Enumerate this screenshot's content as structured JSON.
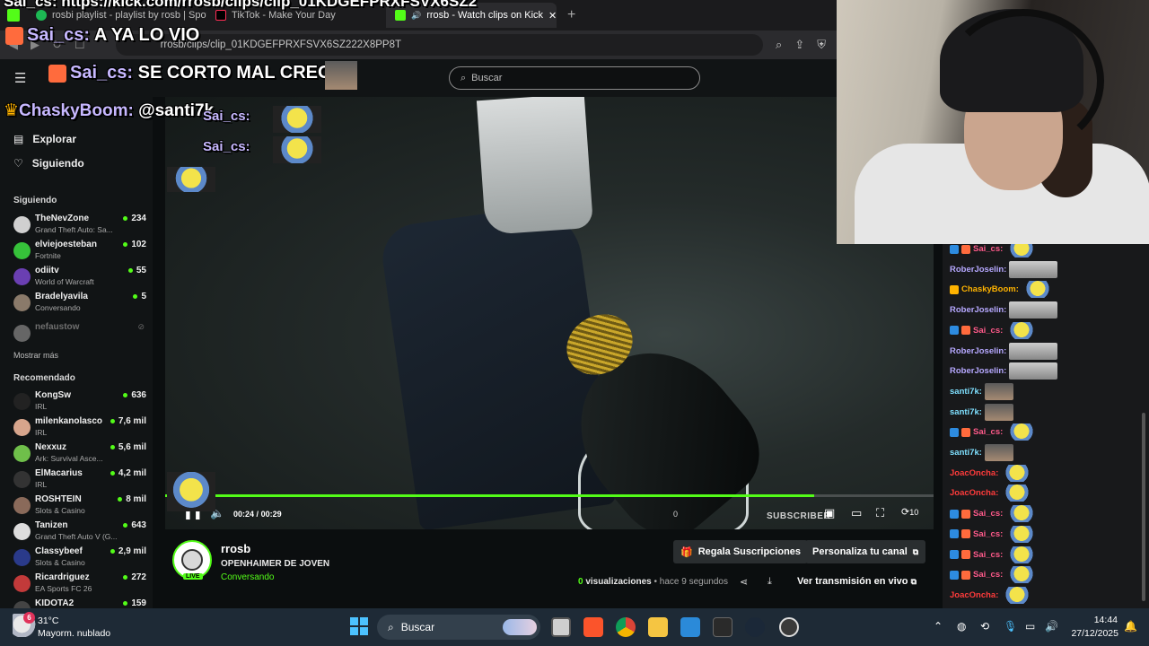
{
  "browser": {
    "tabs": [
      {
        "label": "rosbi playlist - playlist by rosb | Spoti",
        "favicon_color": "#1db954"
      },
      {
        "label": "TikTok - Make Your Day",
        "favicon_color": "#000000"
      },
      {
        "label": "rrosb - Watch clips on Kick",
        "favicon_color": "#53fc18"
      }
    ],
    "new_tab": "+",
    "close_tab": "✕",
    "url": "rrosb/clips/clip_01KDGEFPRXFSVX6SZ222X8PP8T"
  },
  "header": {
    "search_placeholder": "Buscar"
  },
  "sidebar": {
    "nav": [
      {
        "label": "Explorar",
        "icon": "compass-icon"
      },
      {
        "label": "Siguiendo",
        "icon": "heart-icon"
      }
    ],
    "following_title": "Siguiendo",
    "following": [
      {
        "name": "TheNevZone",
        "game": "Grand Theft Auto: Sa...",
        "viewers": "234",
        "avatar_color": "#d0d0d0"
      },
      {
        "name": "elviejoesteban",
        "game": "Fortnite",
        "viewers": "102",
        "avatar_color": "#36c23a"
      },
      {
        "name": "odiitv",
        "game": "World of Warcraft",
        "viewers": "55",
        "avatar_color": "#6a3fb2"
      },
      {
        "name": "Bradelyavila",
        "game": "Conversando",
        "viewers": "5",
        "avatar_color": "#8a7a6a"
      }
    ],
    "offline_channel": "nefaustow",
    "show_more": "Mostrar más",
    "recommended_title": "Recomendado",
    "recommended": [
      {
        "name": "KongSw",
        "game": "IRL",
        "viewers": "636",
        "avatar_color": "#222222"
      },
      {
        "name": "milenkanolasco",
        "game": "IRL",
        "viewers": "7,6 mil",
        "avatar_color": "#d7a58c"
      },
      {
        "name": "Nexxuz",
        "game": "Ark: Survival Asce...",
        "viewers": "5,6 mil",
        "avatar_color": "#6fbf4a"
      },
      {
        "name": "ElMacarius",
        "game": "IRL",
        "viewers": "4,2 mil",
        "avatar_color": "#333333"
      },
      {
        "name": "ROSHTEIN",
        "game": "Slots & Casino",
        "viewers": "8 mil",
        "avatar_color": "#8a6a5a"
      },
      {
        "name": "Tanizen",
        "game": "Grand Theft Auto V (G...",
        "viewers": "643",
        "avatar_color": "#dddddd"
      },
      {
        "name": "Classybeef",
        "game": "Slots & Casino",
        "viewers": "2,9 mil",
        "avatar_color": "#2a3a8a"
      },
      {
        "name": "Ricardriguez",
        "game": "EA Sports FC 26",
        "viewers": "272",
        "avatar_color": "#c23a3a"
      },
      {
        "name": "KIDOTA2",
        "game": "",
        "viewers": "159",
        "avatar_color": "#444444"
      }
    ]
  },
  "player": {
    "current_time": "00:24",
    "separator": "/",
    "duration": "00:29",
    "progress": 0.845,
    "overlay_subscriber": "SUBSCRIBER",
    "overlay_zero": "0",
    "skip_label": "10"
  },
  "channel": {
    "name": "rrosb",
    "live_badge": "LIVE",
    "title": "OPENHAIMER DE JOVEN",
    "category": "Conversando",
    "gift_button": "Regala Suscripciones",
    "customize_button": "Personaliza tu canal",
    "views_count": "0",
    "views_label": "visualizaciones",
    "time_ago": "• hace 9 segundos",
    "watch_live": "Ver transmisión en vivo"
  },
  "stream_overlay": {
    "url": "Sai_cs: https://kick.com/rrosb/clips/clip_01KDGEFPRXFSVX6SZ2",
    "lines": [
      {
        "user": "Sai_cs:",
        "text": "A YA LO VIO"
      },
      {
        "user": "Sai_cs:",
        "text": "SE CORTO MAL CREO"
      },
      {
        "user": "ChaskyBoom:",
        "text": "@santi7k"
      },
      {
        "user": "Sai_cs:",
        "text": ""
      },
      {
        "user": "Sai_cs:",
        "text": ""
      }
    ]
  },
  "chat": [
    {
      "user": "Sai_cs:",
      "color": "#ff5a8a",
      "emote": "min"
    },
    {
      "user": "RoberJoselin:",
      "color": "#b6a8ff",
      "emote": "pic"
    },
    {
      "user": "ChaskyBoom:",
      "color": "#ffb300",
      "emote": "min"
    },
    {
      "user": "RoberJoselin:",
      "color": "#b6a8ff",
      "emote": "pic"
    },
    {
      "user": "Sai_cs:",
      "color": "#ff5a8a",
      "emote": "min"
    },
    {
      "user": "RoberJoselin:",
      "color": "#b6a8ff",
      "emote": "pic"
    },
    {
      "user": "RoberJoselin:",
      "color": "#b6a8ff",
      "emote": "pic"
    },
    {
      "user": "santi7k:",
      "color": "#7fe0ff",
      "emote": "man"
    },
    {
      "user": "santi7k:",
      "color": "#7fe0ff",
      "emote": "man"
    },
    {
      "user": "Sai_cs:",
      "color": "#ff5a8a",
      "emote": "min"
    },
    {
      "user": "santi7k:",
      "color": "#7fe0ff",
      "emote": "man"
    },
    {
      "user": "JoacOncha:",
      "color": "#ff3b3b",
      "emote": "min"
    },
    {
      "user": "JoacOncha:",
      "color": "#ff3b3b",
      "emote": "min"
    },
    {
      "user": "Sai_cs:",
      "color": "#ff5a8a",
      "emote": "min"
    },
    {
      "user": "Sai_cs:",
      "color": "#ff5a8a",
      "emote": "min"
    },
    {
      "user": "Sai_cs:",
      "color": "#ff5a8a",
      "emote": "min"
    },
    {
      "user": "Sai_cs:",
      "color": "#ff5a8a",
      "emote": "min"
    },
    {
      "user": "JoacOncha:",
      "color": "#ff3b3b",
      "emote": "min"
    }
  ],
  "taskbar": {
    "notification_count": "6",
    "temperature": "31°C",
    "weather": "Mayorm. nublado",
    "search": "Buscar",
    "time": "14:44",
    "date": "27/12/2025"
  },
  "colors": {
    "kick_green": "#53fc18",
    "background": "#0b0e0f",
    "sidebar": "#111415"
  }
}
